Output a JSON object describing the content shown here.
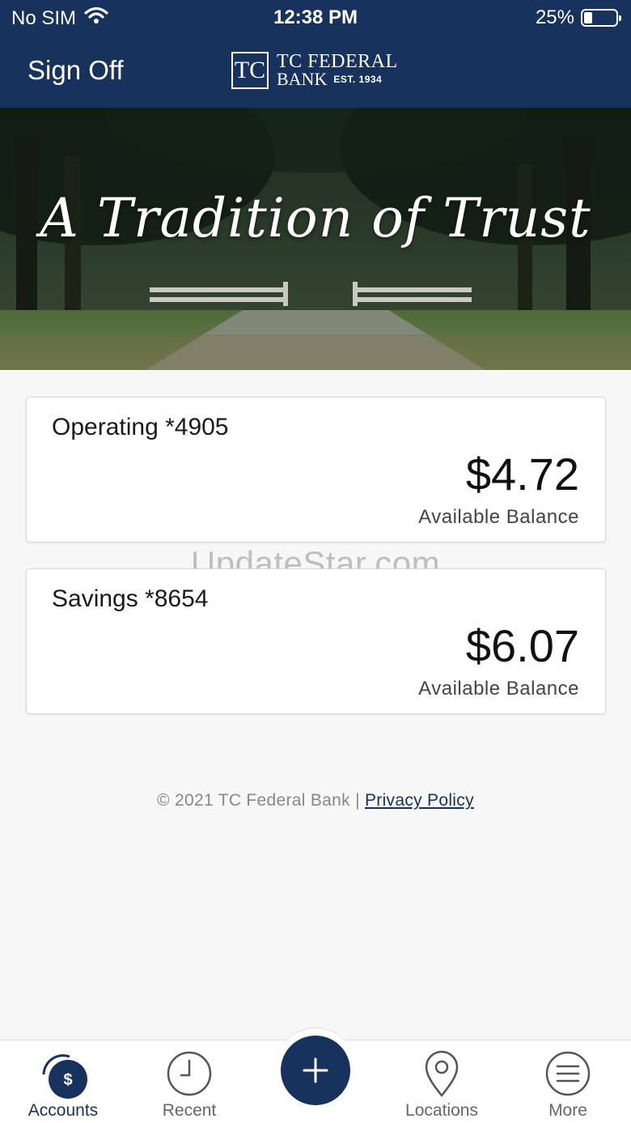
{
  "status_bar": {
    "carrier": "No SIM",
    "time": "12:38 PM",
    "battery_percent": "25%",
    "battery_level": 0.25
  },
  "header": {
    "sign_off_label": "Sign Off",
    "logo_line1": "TC FEDERAL",
    "logo_line2": "BANK",
    "logo_est": "EST. 1934",
    "logo_mark": "TC",
    "background_color": "#17325c"
  },
  "hero": {
    "tagline": "A Tradition of Trust"
  },
  "accounts": [
    {
      "name": "Operating *4905",
      "balance": "$4.72",
      "balance_label": "Available Balance"
    },
    {
      "name": "Savings *8654",
      "balance": "$6.07",
      "balance_label": "Available Balance"
    }
  ],
  "watermark": "UpdateStar.com",
  "footer": {
    "copyright": "© 2021 TC Federal Bank |",
    "privacy_link": "Privacy Policy"
  },
  "tabbar": {
    "items": [
      {
        "label": "Accounts",
        "icon": "dollar-coin-icon",
        "active": true
      },
      {
        "label": "Recent",
        "icon": "clock-icon",
        "active": false
      },
      {
        "label": "",
        "icon": "plus-icon",
        "active": false
      },
      {
        "label": "Locations",
        "icon": "map-pin-icon",
        "active": false
      },
      {
        "label": "More",
        "icon": "menu-icon",
        "active": false
      }
    ]
  }
}
